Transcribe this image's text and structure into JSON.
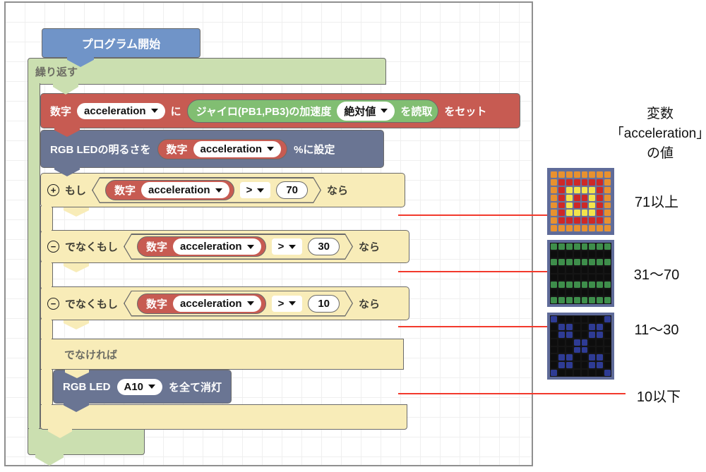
{
  "program": {
    "start_label": "プログラム開始",
    "repeat_label": "繰り返す",
    "set_block": {
      "num_label": "数字",
      "variable": "acceleration",
      "particle": "に",
      "gyro_label": "ジャイロ(PB1,PB3)の加速度",
      "abs_value": "絶対値",
      "read_label": "を読取",
      "set_label": "をセット"
    },
    "brightness_block": {
      "prefix": "RGB LEDの明るさを",
      "num_label": "数字",
      "variable": "acceleration",
      "suffix": "%に設定"
    },
    "conditions": [
      {
        "toggle": "+",
        "keyword": "もし",
        "num_label": "数字",
        "variable": "acceleration",
        "op": ">",
        "threshold": "70",
        "suffix": "なら"
      },
      {
        "toggle": "−",
        "keyword": "でなくもし",
        "num_label": "数字",
        "variable": "acceleration",
        "op": ">",
        "threshold": "30",
        "suffix": "なら"
      },
      {
        "toggle": "−",
        "keyword": "でなくもし",
        "num_label": "数字",
        "variable": "acceleration",
        "op": ">",
        "threshold": "10",
        "suffix": "なら"
      }
    ],
    "else_label": "でなければ",
    "led_off_block": {
      "prefix": "RGB LED",
      "port": "A10",
      "suffix": "を全て消灯"
    }
  },
  "legend": {
    "title_lines": [
      "変数",
      "「acceleration」",
      "の値"
    ],
    "labels": [
      "71以上",
      "31〜70",
      "11〜30",
      "10以下"
    ],
    "matrices": [
      {
        "name": "led-matrix-71-plus",
        "frame": "#5F6B99",
        "gap": "#66719B",
        "cell_colors": {
          "O": "#E8912F",
          "R": "#CE2827",
          "Y": "#F3E44C"
        },
        "rows": [
          "OOOOOOOO",
          "ORRRRRRO",
          "ORYYYYRO",
          "ORYRRYRO",
          "ORYRRYRO",
          "ORYYYYRO",
          "ORRRRRRO",
          "OOOOOOOO"
        ]
      },
      {
        "name": "led-matrix-31-70",
        "frame": "#5F6B99",
        "gap": "#151515",
        "cell_colors": {
          "G": "#3E8E4B",
          "K": "#0d0d0d"
        },
        "rows": [
          "GGGGGGGG",
          "KKKKKKKK",
          "GGGGGGGG",
          "KKKKKKKK",
          "KKKKKKKK",
          "GGGGGGGG",
          "KKKKKKKK",
          "GGGGGGGG"
        ]
      },
      {
        "name": "led-matrix-11-30",
        "frame": "#5F6B99",
        "gap": "#151515",
        "cell_colors": {
          "B": "#2E3B94",
          "K": "#0d0d0d"
        },
        "rows": [
          "BKKKKKKB",
          "KBBKKBBK",
          "KBBKKBBK",
          "KKKBBKKK",
          "KKKBBKKK",
          "KBBKKBBK",
          "KBBKKBBK",
          "BKKKKKKB"
        ]
      }
    ]
  },
  "colors": {
    "start_block": "#7094C8",
    "repeat_block": "#CBDFB0",
    "action_red": "#C75B52",
    "reporter_green": "#81BE72",
    "slate_blue": "#6A7593",
    "if_yellow": "#F8ECB8",
    "connector_line": "#F2392C",
    "block_border": "#6b6b6b"
  }
}
